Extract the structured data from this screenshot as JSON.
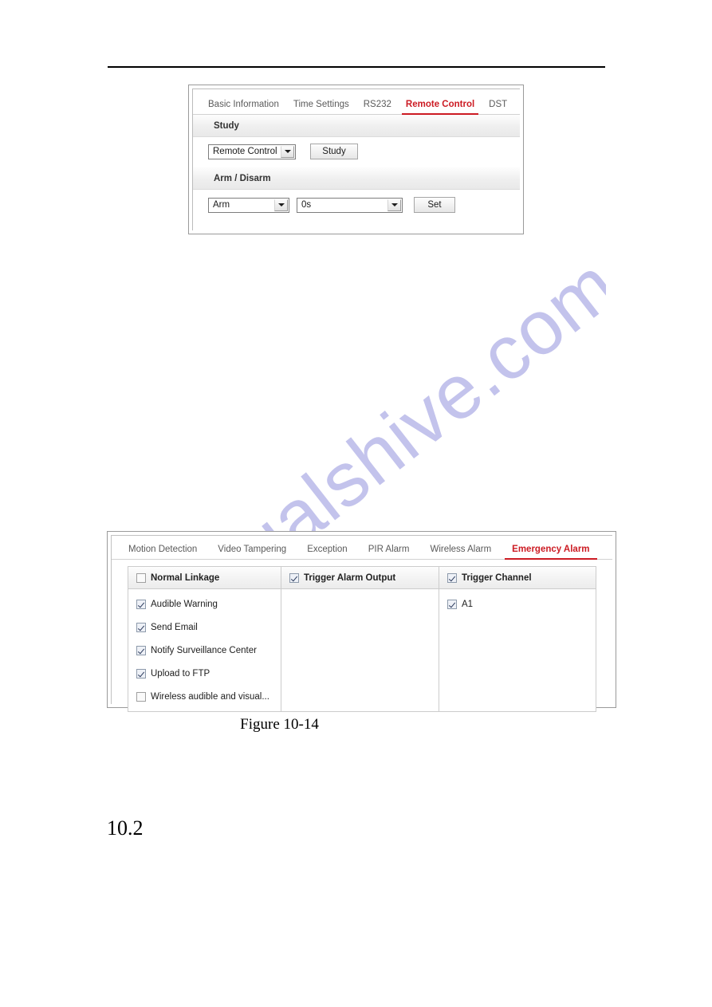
{
  "document": {
    "figure_caption": "Figure 10-14",
    "section_number": "10.2",
    "watermark": "manualshive.com",
    "watermark_color": "#c3c3ec",
    "accent_color": "#cc1b23"
  },
  "panel_remote_control": {
    "tabs": [
      {
        "label": "Basic Information",
        "active": false
      },
      {
        "label": "Time Settings",
        "active": false
      },
      {
        "label": "RS232",
        "active": false
      },
      {
        "label": "Remote Control",
        "active": true
      },
      {
        "label": "DST",
        "active": false
      }
    ],
    "study_section": {
      "title": "Study",
      "device_select_value": "Remote Control",
      "study_button": "Study"
    },
    "arm_section": {
      "title": "Arm / Disarm",
      "mode_select_value": "Arm",
      "delay_select_value": "0s",
      "set_button": "Set"
    }
  },
  "panel_emergency_alarm": {
    "tabs": [
      {
        "label": "Motion Detection",
        "active": false
      },
      {
        "label": "Video Tampering",
        "active": false
      },
      {
        "label": "Exception",
        "active": false
      },
      {
        "label": "PIR Alarm",
        "active": false
      },
      {
        "label": "Wireless Alarm",
        "active": false
      },
      {
        "label": "Emergency Alarm",
        "active": true
      }
    ],
    "columns": [
      {
        "header": "Normal Linkage",
        "header_checked": false,
        "items": [
          {
            "label": "Audible Warning",
            "checked": true
          },
          {
            "label": "Send Email",
            "checked": true
          },
          {
            "label": "Notify Surveillance Center",
            "checked": true
          },
          {
            "label": "Upload to FTP",
            "checked": true
          },
          {
            "label": "Wireless audible and visual...",
            "checked": false
          }
        ]
      },
      {
        "header": "Trigger Alarm Output",
        "header_checked": true,
        "items": []
      },
      {
        "header": "Trigger Channel",
        "header_checked": true,
        "items": [
          {
            "label": "A1",
            "checked": true
          }
        ]
      }
    ]
  }
}
